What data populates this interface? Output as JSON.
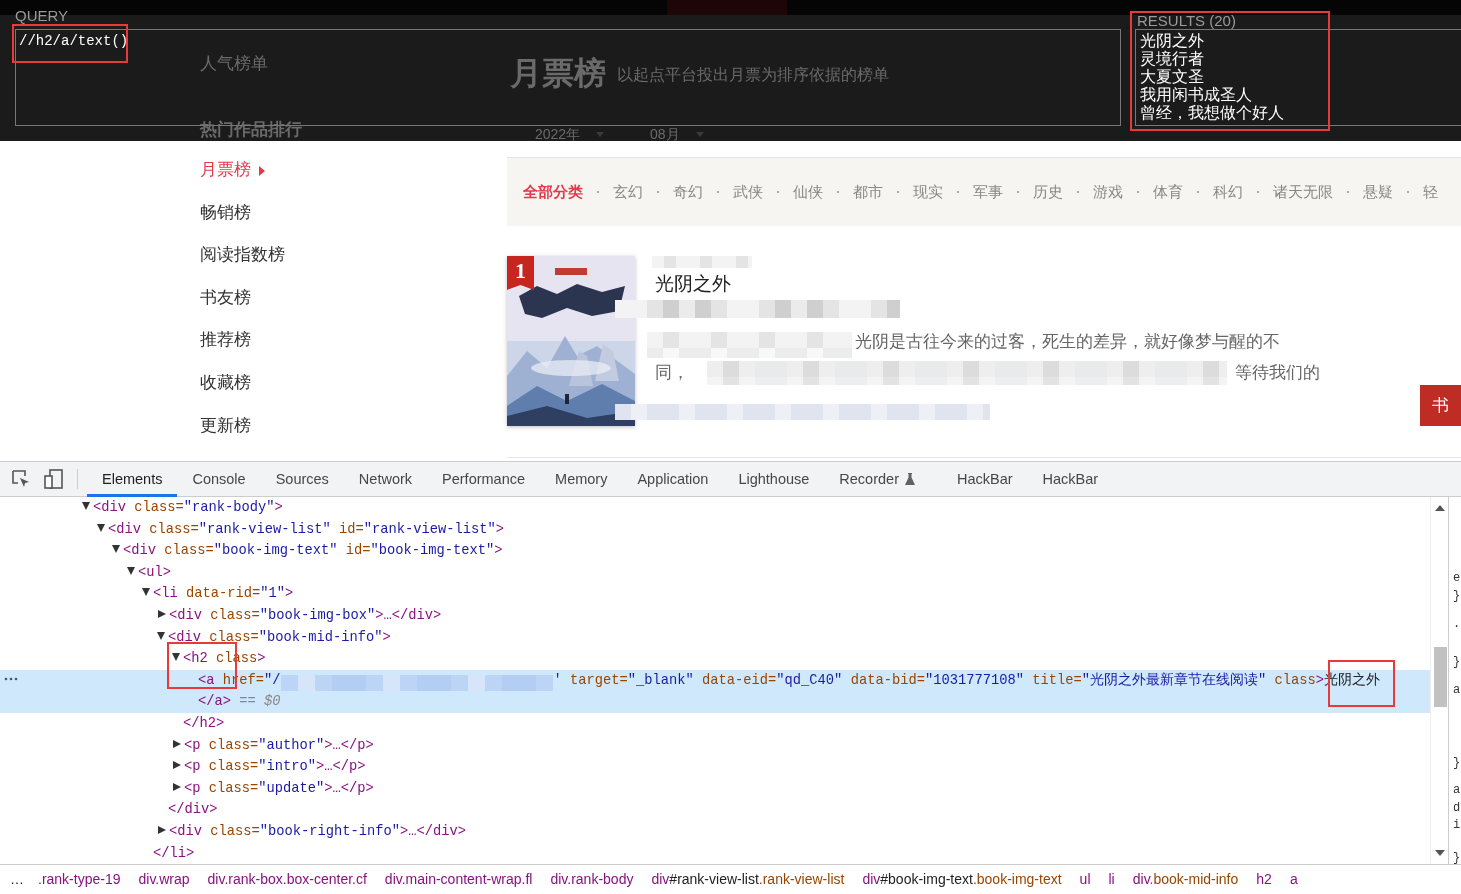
{
  "xpath_helper": {
    "query_label": "QUERY",
    "query": "//h2/a/text()",
    "results_label": "RESULTS (20)",
    "results": [
      "光阴之外",
      "灵境行者",
      "大夏文圣",
      "我用闲书成圣人",
      "曾经，我想做个好人"
    ]
  },
  "page_header": {
    "section_title": "人气榜单",
    "rank_title": "月票榜",
    "rank_subtitle": "以起点平台投出月票为排序依据的榜单",
    "hot_title": "热门作品排行",
    "year": "2022年",
    "month": "08月"
  },
  "rank_nav": [
    {
      "label": "月票榜",
      "selected": true
    },
    {
      "label": "畅销榜",
      "selected": false
    },
    {
      "label": "阅读指数榜",
      "selected": false
    },
    {
      "label": "书友榜",
      "selected": false
    },
    {
      "label": "推荐榜",
      "selected": false
    },
    {
      "label": "收藏榜",
      "selected": false
    },
    {
      "label": "更新榜",
      "selected": false
    }
  ],
  "categories": [
    {
      "label": "全部分类",
      "selected": true
    },
    {
      "label": "玄幻",
      "selected": false
    },
    {
      "label": "奇幻",
      "selected": false
    },
    {
      "label": "武侠",
      "selected": false
    },
    {
      "label": "仙侠",
      "selected": false
    },
    {
      "label": "都市",
      "selected": false
    },
    {
      "label": "现实",
      "selected": false
    },
    {
      "label": "军事",
      "selected": false
    },
    {
      "label": "历史",
      "selected": false
    },
    {
      "label": "游戏",
      "selected": false
    },
    {
      "label": "体育",
      "selected": false
    },
    {
      "label": "科幻",
      "selected": false
    },
    {
      "label": "诸天无限",
      "selected": false
    },
    {
      "label": "悬疑",
      "selected": false
    },
    {
      "label": "轻",
      "selected": false
    }
  ],
  "book": {
    "rank": "1",
    "title": "光阴之外",
    "intro_line_1": "光阴是古往今来的过客，死生的差异，就好像梦与醒的不",
    "intro_line_2_start": "同，",
    "intro_line_2_end": "等待我们的",
    "button": "书"
  },
  "devtools": {
    "tabs": [
      {
        "label": "Elements",
        "selected": true
      },
      {
        "label": "Console",
        "selected": false
      },
      {
        "label": "Sources",
        "selected": false
      },
      {
        "label": "Network",
        "selected": false
      },
      {
        "label": "Performance",
        "selected": false
      },
      {
        "label": "Memory",
        "selected": false
      },
      {
        "label": "Application",
        "selected": false
      },
      {
        "label": "Lighthouse",
        "selected": false
      },
      {
        "label": "Recorder",
        "selected": false,
        "kind": "experiment"
      },
      {
        "label": "HackBar",
        "selected": false
      },
      {
        "label": "HackBar",
        "selected": false
      }
    ],
    "dom_lines": [
      {
        "selected": false,
        "expanded": true,
        "tokens": [
          {
            "kind": "tag",
            "text": "<div"
          },
          {
            "kind": "attr",
            "text": " class="
          },
          {
            "kind": "value",
            "text": "\"rank-body\""
          },
          {
            "kind": "tag",
            "text": ">"
          }
        ]
      },
      {
        "selected": false,
        "expanded": true,
        "tokens": [
          {
            "kind": "tag",
            "text": "<div"
          },
          {
            "kind": "attr",
            "text": " class="
          },
          {
            "kind": "value",
            "text": "\"rank-view-list\""
          },
          {
            "kind": "attr",
            "text": " id="
          },
          {
            "kind": "value",
            "text": "\"rank-view-list\""
          },
          {
            "kind": "tag",
            "text": ">"
          }
        ]
      },
      {
        "selected": false,
        "expanded": true,
        "tokens": [
          {
            "kind": "tag",
            "text": "<div"
          },
          {
            "kind": "attr",
            "text": " class="
          },
          {
            "kind": "value",
            "text": "\"book-img-text\""
          },
          {
            "kind": "attr",
            "text": " id="
          },
          {
            "kind": "value",
            "text": "\"book-img-text\""
          },
          {
            "kind": "tag",
            "text": ">"
          }
        ]
      },
      {
        "selected": false,
        "expanded": true,
        "tokens": [
          {
            "kind": "tag",
            "text": "<ul>"
          }
        ]
      },
      {
        "selected": false,
        "expanded": true,
        "tokens": [
          {
            "kind": "tag",
            "text": "<li"
          },
          {
            "kind": "attr",
            "text": " data-rid="
          },
          {
            "kind": "value",
            "text": "\"1\""
          },
          {
            "kind": "tag",
            "text": ">"
          }
        ]
      },
      {
        "selected": false,
        "expanded": false,
        "tokens": [
          {
            "kind": "tag",
            "text": "<div"
          },
          {
            "kind": "attr",
            "text": " class="
          },
          {
            "kind": "value",
            "text": "\"book-img-box\""
          },
          {
            "kind": "tag",
            "text": ">…</div>"
          }
        ]
      },
      {
        "selected": false,
        "expanded": true,
        "tokens": [
          {
            "kind": "tag",
            "text": "<div"
          },
          {
            "kind": "attr",
            "text": " class="
          },
          {
            "kind": "value",
            "text": "\"book-mid-info\""
          },
          {
            "kind": "tag",
            "text": ">"
          }
        ]
      },
      {
        "selected": false,
        "expanded": true,
        "tokens": [
          {
            "kind": "tag",
            "text": "<h2"
          },
          {
            "kind": "attr",
            "text": " class"
          },
          {
            "kind": "tag",
            "text": ">"
          }
        ]
      },
      {
        "selected": true,
        "tokens": [
          {
            "kind": "tag",
            "text": "<a"
          },
          {
            "kind": "attr",
            "text": " href="
          },
          {
            "kind": "value",
            "text": "\"/"
          },
          {
            "kind": "redacted"
          },
          {
            "kind": "value",
            "text": "'"
          },
          {
            "kind": "attr",
            "text": " target="
          },
          {
            "kind": "value",
            "text": "\"_blank\""
          },
          {
            "kind": "attr",
            "text": " data-eid="
          },
          {
            "kind": "value",
            "text": "\"qd_C40\""
          },
          {
            "kind": "attr",
            "text": " data-bid="
          },
          {
            "kind": "value",
            "text": "\"1031777108\""
          },
          {
            "kind": "attr",
            "text": " title="
          },
          {
            "kind": "value",
            "text": "\"光阴之外最新章节在线阅读\""
          },
          {
            "kind": "attr",
            "text": " class"
          },
          {
            "kind": "tag",
            "text": ">"
          },
          {
            "kind": "text",
            "text": "光阴之外"
          }
        ]
      },
      {
        "selected": true,
        "tokens": [
          {
            "kind": "tag",
            "text": "</a>"
          },
          {
            "kind": "note",
            "text": " == $0"
          }
        ]
      },
      {
        "selected": false,
        "tokens": [
          {
            "kind": "tag",
            "text": "</h2>"
          }
        ]
      },
      {
        "selected": false,
        "expanded": false,
        "tokens": [
          {
            "kind": "tag",
            "text": "<p"
          },
          {
            "kind": "attr",
            "text": " class="
          },
          {
            "kind": "value",
            "text": "\"author\""
          },
          {
            "kind": "tag",
            "text": ">…</p>"
          }
        ]
      },
      {
        "selected": false,
        "expanded": false,
        "tokens": [
          {
            "kind": "tag",
            "text": "<p"
          },
          {
            "kind": "attr",
            "text": " class="
          },
          {
            "kind": "value",
            "text": "\"intro\""
          },
          {
            "kind": "tag",
            "text": ">…</p>"
          }
        ]
      },
      {
        "selected": false,
        "expanded": false,
        "tokens": [
          {
            "kind": "tag",
            "text": "<p"
          },
          {
            "kind": "attr",
            "text": " class="
          },
          {
            "kind": "value",
            "text": "\"update\""
          },
          {
            "kind": "tag",
            "text": ">…</p>"
          }
        ]
      },
      {
        "selected": false,
        "tokens": [
          {
            "kind": "tag",
            "text": "</div>"
          }
        ]
      },
      {
        "selected": false,
        "expanded": false,
        "tokens": [
          {
            "kind": "tag",
            "text": "<div"
          },
          {
            "kind": "attr",
            "text": " class="
          },
          {
            "kind": "value",
            "text": "\"book-right-info\""
          },
          {
            "kind": "tag",
            "text": ">…</div>"
          }
        ]
      },
      {
        "selected": false,
        "tokens": [
          {
            "kind": "tag",
            "text": "</li>"
          }
        ]
      }
    ],
    "side_fragments": [
      "e",
      "}",
      ".",
      "}",
      "a",
      "}",
      "a",
      "d",
      "i",
      "}"
    ],
    "breadcrumb_more": "…",
    "breadcrumbs": [
      [
        {
          "kind": "tag",
          "text": ".rank-type-19"
        }
      ],
      [
        {
          "kind": "tag",
          "text": "div.wrap"
        }
      ],
      [
        {
          "kind": "tag",
          "text": "div.rank-box.box-center.cf"
        }
      ],
      [
        {
          "kind": "tag",
          "text": "div.main-content-wrap.fl"
        }
      ],
      [
        {
          "kind": "tag",
          "text": "div.rank-body"
        }
      ],
      [
        {
          "kind": "tag",
          "text": "div"
        },
        {
          "kind": "id",
          "text": "#rank-view-list"
        },
        {
          "kind": "class",
          "text": ".rank-view-list"
        }
      ],
      [
        {
          "kind": "tag",
          "text": "div"
        },
        {
          "kind": "id",
          "text": "#book-img-text"
        },
        {
          "kind": "class",
          "text": ".book-img-text"
        }
      ],
      [
        {
          "kind": "tag",
          "text": "ul"
        }
      ],
      [
        {
          "kind": "tag",
          "text": "li"
        }
      ],
      [
        {
          "kind": "tag",
          "text": "div"
        },
        {
          "kind": "class",
          "text": ".book-mid-info"
        }
      ],
      [
        {
          "kind": "tag",
          "text": "h2"
        }
      ],
      [
        {
          "kind": "tag",
          "text": "a"
        }
      ]
    ]
  }
}
